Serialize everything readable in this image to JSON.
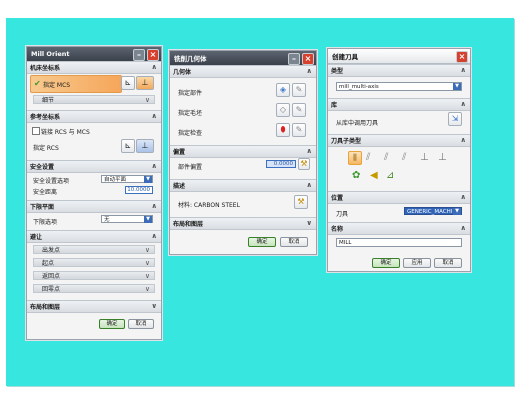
{
  "dlg1": {
    "title": "Mill Orient",
    "sec_mcs": "机床坐标系",
    "specify_mcs": "指定 MCS",
    "detail": "细节",
    "sec_ref": "参考坐标系",
    "link_rcs": "链接 RCS 与 MCS",
    "specify_rcs": "指定 RCS",
    "sec_clear": "安全设置",
    "clear_option_label": "安全设置选项",
    "clear_option_value": "自动平面",
    "clear_dist_label": "安全距离",
    "clear_dist_value": "10.0000",
    "sec_lower": "下限平面",
    "lower_option_label": "下限选项",
    "lower_option_value": "无",
    "sec_avoid": "避让",
    "from_point": "出发点",
    "start_point": "起点",
    "return_point": "返回点",
    "home_point": "回零点",
    "sec_layout": "布局和图层",
    "ok": "确定",
    "cancel": "取消"
  },
  "dlg2": {
    "title": "铣削几何体",
    "sec_geom": "几何体",
    "specify_part": "指定部件",
    "specify_blank": "指定毛坯",
    "specify_check": "指定检查",
    "sec_offset": "偏置",
    "part_offset_label": "部件偏置",
    "part_offset_value": "0.0000",
    "sec_desc": "描述",
    "material": "材料: CARBON STEEL",
    "sec_layout": "布局和图层",
    "ok": "确定",
    "cancel": "取消"
  },
  "dlg3": {
    "title": "创建刀具",
    "sec_type": "类型",
    "type_value": "mill_multi-axis",
    "sec_library": "库",
    "library_label": "从库中调用刀具",
    "sec_subtype": "刀具子类型",
    "sec_location": "位置",
    "tool_label": "刀具",
    "tool_value": "GENERIC_MACHI",
    "sec_name": "名称",
    "name_value": "MILL",
    "ok": "确定",
    "apply": "应用",
    "cancel": "取消"
  }
}
